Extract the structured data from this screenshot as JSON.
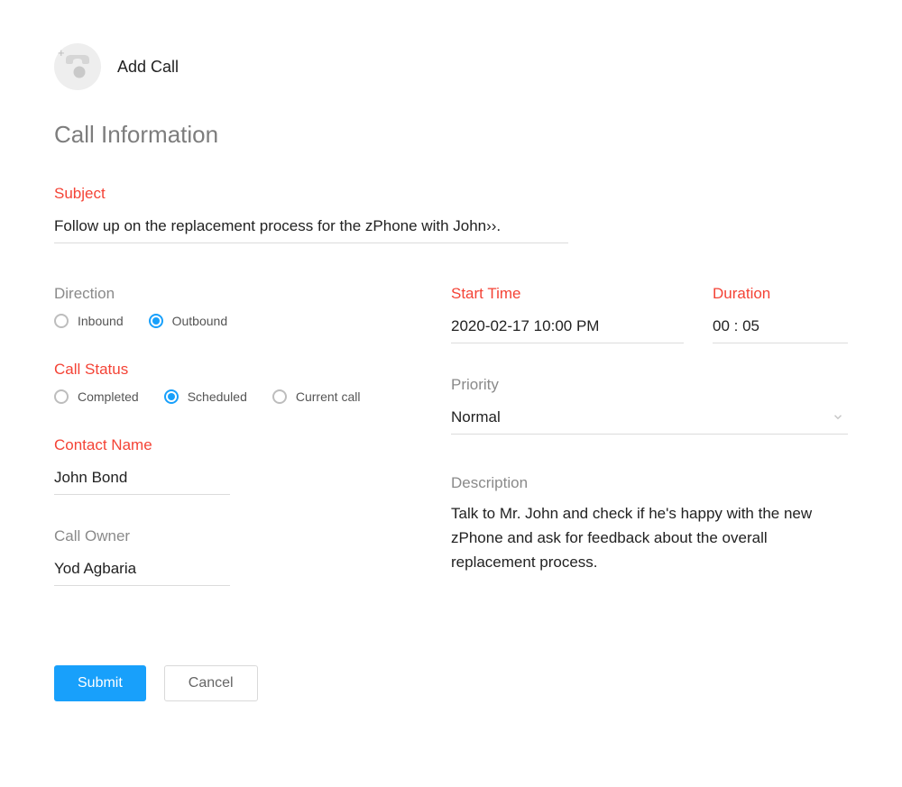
{
  "header": {
    "title": "Add Call"
  },
  "section_title": "Call Information",
  "subject": {
    "label": "Subject",
    "value": "Follow up on the replacement process for the zPhone with John››."
  },
  "direction": {
    "label": "Direction",
    "options": [
      {
        "label": "Inbound",
        "checked": false
      },
      {
        "label": "Outbound",
        "checked": true
      }
    ]
  },
  "call_status": {
    "label": "Call Status",
    "options": [
      {
        "label": "Completed",
        "checked": false
      },
      {
        "label": "Scheduled",
        "checked": true
      },
      {
        "label": "Current call",
        "checked": false
      }
    ]
  },
  "contact_name": {
    "label": "Contact Name",
    "value": "John Bond"
  },
  "call_owner": {
    "label": "Call Owner",
    "value": "Yod Agbaria"
  },
  "start_time": {
    "label": "Start Time",
    "value": "2020-02-17 10:00 PM"
  },
  "duration": {
    "label": "Duration",
    "value": "00 : 05"
  },
  "priority": {
    "label": "Priority",
    "value": "Normal"
  },
  "description": {
    "label": "Description",
    "value": "Talk to Mr. John and check if he's happy with the new zPhone and ask for feedback about the overall replacement process."
  },
  "actions": {
    "submit": "Submit",
    "cancel": "Cancel"
  }
}
